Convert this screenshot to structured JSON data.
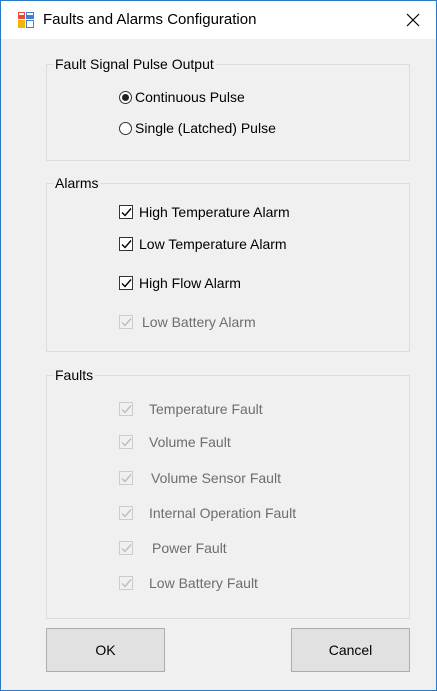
{
  "window": {
    "title": "Faults and Alarms Configuration",
    "app_icon": "form-window-icon",
    "close_icon": "close-icon"
  },
  "pulse_group": {
    "legend": "Fault Signal Pulse Output",
    "options": [
      {
        "label": "Continuous Pulse",
        "selected": true
      },
      {
        "label": "Single (Latched) Pulse",
        "selected": false
      }
    ]
  },
  "alarms_group": {
    "legend": "Alarms",
    "items": [
      {
        "label": "High Temperature Alarm",
        "checked": true,
        "enabled": true
      },
      {
        "label": "Low Temperature Alarm",
        "checked": true,
        "enabled": true
      },
      {
        "label": "High Flow Alarm",
        "checked": true,
        "enabled": true
      },
      {
        "label": "Low Battery Alarm",
        "checked": true,
        "enabled": false
      }
    ]
  },
  "faults_group": {
    "legend": "Faults",
    "items": [
      {
        "label": "Temperature Fault",
        "checked": true,
        "enabled": false
      },
      {
        "label": "Volume Fault",
        "checked": true,
        "enabled": false
      },
      {
        "label": "Volume Sensor Fault",
        "checked": true,
        "enabled": false
      },
      {
        "label": "Internal Operation Fault",
        "checked": true,
        "enabled": false
      },
      {
        "label": "Power Fault",
        "checked": true,
        "enabled": false
      },
      {
        "label": "Low Battery Fault",
        "checked": true,
        "enabled": false
      }
    ]
  },
  "buttons": {
    "ok_label": "OK",
    "cancel_label": "Cancel"
  },
  "colors": {
    "window_border": "#2b79c4",
    "dialog_background": "#f0f0f0",
    "disabled_text": "#6d6d6d",
    "disabled_check": "#bdbdbd"
  }
}
